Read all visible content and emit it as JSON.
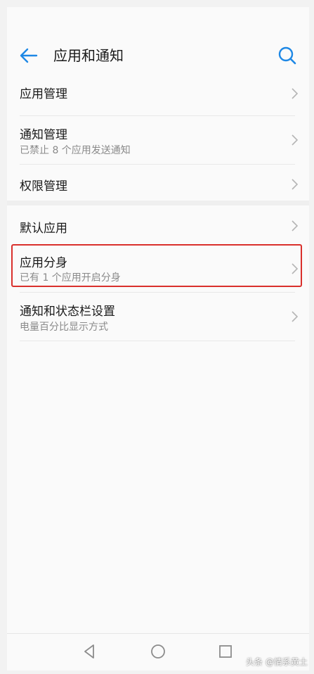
{
  "header": {
    "title": "应用和通知",
    "back_icon": "back-arrow-icon",
    "search_icon": "search-icon",
    "accent_color": "#1e88e5"
  },
  "groups": [
    {
      "items": [
        {
          "title": "应用管理",
          "subtitle": ""
        },
        {
          "title": "通知管理",
          "subtitle": "已禁止 8 个应用发送通知"
        },
        {
          "title": "权限管理",
          "subtitle": ""
        }
      ]
    },
    {
      "items": [
        {
          "title": "默认应用",
          "subtitle": ""
        },
        {
          "title": "应用分身",
          "subtitle": "已有 1 个应用开启分身",
          "highlighted": true
        },
        {
          "title": "通知和状态栏设置",
          "subtitle": "电量百分比显示方式"
        }
      ]
    }
  ],
  "highlight_color": "#d9302c",
  "navbar": {
    "back_icon": "nav-back-triangle-icon",
    "home_icon": "nav-home-circle-icon",
    "recents_icon": "nav-recents-square-icon"
  },
  "watermark": "头条 @情系黄土"
}
